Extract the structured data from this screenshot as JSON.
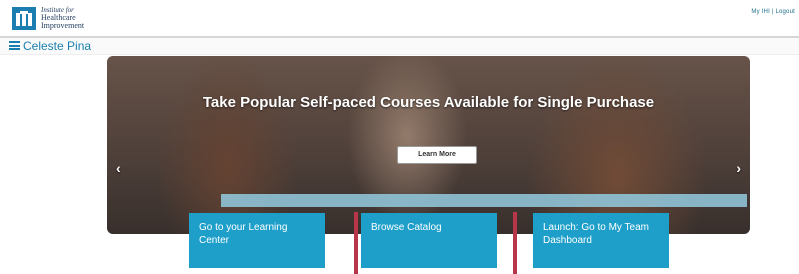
{
  "header": {
    "logo_lines": [
      "Institute for",
      "Healthcare",
      "Improvement"
    ],
    "top_links": "My IHI | Logout"
  },
  "user": {
    "name": "Celeste Pina"
  },
  "banner": {
    "title": "Take Popular Self-paced Courses Available for Single Purchase",
    "learn_more": "Learn More",
    "prev_arrow": "‹",
    "next_arrow": "›"
  },
  "tiles": [
    {
      "label": "Go to your Learning Center"
    },
    {
      "label": "Browse Catalog"
    },
    {
      "label": "Launch: Go to My Team Dashboard"
    }
  ],
  "colors": {
    "brand_blue": "#1a7fb0",
    "tile_blue": "#1e9fc9",
    "accent_red": "#b8364a"
  }
}
